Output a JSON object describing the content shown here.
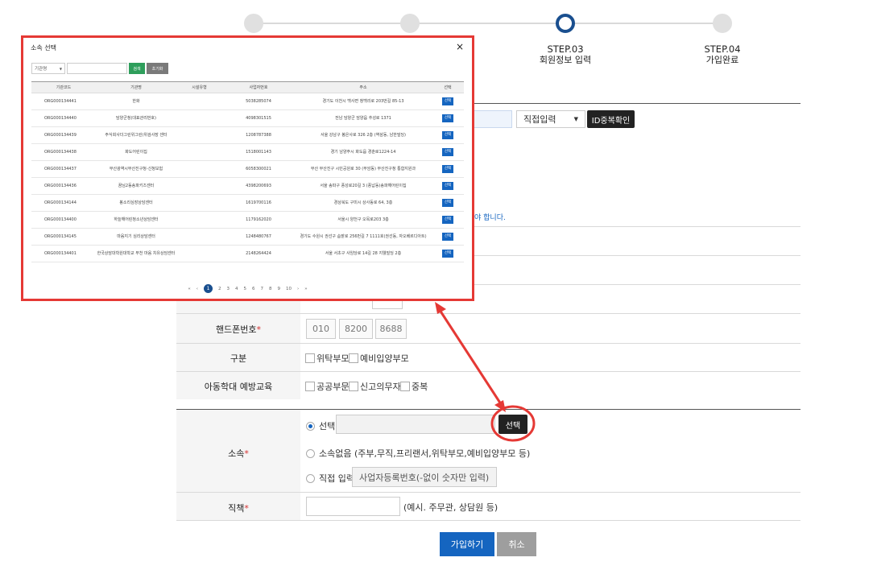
{
  "steps": [
    {
      "num": "",
      "label": ""
    },
    {
      "num": "",
      "label": ""
    },
    {
      "num": "STEP.03",
      "label": "회원정보 입력"
    },
    {
      "num": "STEP.04",
      "label": "가입완료"
    }
  ],
  "id_row": {
    "domain_select": "직접입력",
    "check_button": "ID중복확인"
  },
  "notice_fragment": "야 합니다.",
  "phone": {
    "label": "핸드폰번호",
    "parts": [
      "010",
      "8200",
      "8688"
    ]
  },
  "category": {
    "label": "구분",
    "options": [
      "위탁부모",
      "예비입양부모"
    ]
  },
  "education": {
    "label": "아동학대 예방교육",
    "options": [
      "공공부문",
      "신고의무자",
      "중복"
    ]
  },
  "affiliation": {
    "label": "소속",
    "select_option": "선택",
    "select_button": "선택",
    "none_option": "소속없음 (주부,무직,프리랜서,위탁부모,예비입양부모 등)",
    "direct_option": "직접 입력",
    "direct_placeholder": "사업자등록번호(-없이 숫자만 입력)"
  },
  "position": {
    "label": "직책",
    "hint": "(예시. 주무관, 상담원 등)"
  },
  "buttons": {
    "submit": "가입하기",
    "cancel": "취소"
  },
  "modal": {
    "title": "소속 선택",
    "close": "×",
    "search_select": "기관명",
    "search_button": "검색",
    "reset_button": "초기화",
    "columns": [
      "기관코드",
      "기관명",
      "시설유형",
      "사업자번호",
      "주소",
      "선택"
    ],
    "rows": [
      {
        "code": "ORG000134441",
        "name": "한화",
        "type": "",
        "biz": "5038285074",
        "addr": "경기도 이천시 백사면 청백리로 203번길 85-13",
        "sel": "선택"
      },
      {
        "code": "ORG000134440",
        "name": "담양군청(대표관리번호)",
        "type": "",
        "biz": "4098301515",
        "addr": "전남 담양군 담양읍 추성로 1371",
        "sel": "선택"
      },
      {
        "code": "ORG000134439",
        "name": "주식회사더그린위그린(위검사장 센터",
        "type": "",
        "biz": "1208787388",
        "addr": "서울 강남구 봉은사로 326 2층 (역삼동, 남한빌딩)",
        "sel": "선택"
      },
      {
        "code": "ORG000134438",
        "name": "화도어린이집",
        "type": "",
        "biz": "1518001143",
        "addr": "경기 남양주시 화도읍 경춘로1224-14",
        "sel": "선택"
      },
      {
        "code": "ORG000134437",
        "name": "부산광역시부산진구청-신청보험",
        "type": "",
        "biz": "6058300021",
        "addr": "부산 부산진구 시민공원로 30 (부암동) 부산진구청 통합지원과",
        "sel": "선택"
      },
      {
        "code": "ORG000134436",
        "name": "꿈님2동송파키즈센터",
        "type": "",
        "biz": "4398200693",
        "addr": "서울 송파구 풍성로20길 3 (풍납동)송파해어린이집",
        "sel": "선택"
      },
      {
        "code": "ORG000134144",
        "name": "봉소리심장상담센터",
        "type": "",
        "biz": "1619700116",
        "addr": "경상북도 구미시 상사동로 64, 3층",
        "sel": "선택"
      },
      {
        "code": "ORG000134400",
        "name": "하늘해어린청소년상담센터",
        "type": "",
        "biz": "1179162020",
        "addr": "서울시 양천구 오목로203 3층",
        "sel": "선택"
      },
      {
        "code": "ORG000134145",
        "name": "마음지기 심리상담센터",
        "type": "",
        "biz": "1248480767",
        "addr": "경기도 수원시 권선구 솜밭로 256번길 7 1111호(권선동, 자오베르디아트)",
        "sel": "선택"
      },
      {
        "code": "ORG000134401",
        "name": "한국상담대학원대학교 부천 마음 치유상담센터",
        "type": "",
        "biz": "2148264424",
        "addr": "서울 서초구 사임당로 14길 28 지웰빌딩 2층",
        "sel": "선택"
      }
    ],
    "pager": {
      "first": "«",
      "prev": "‹",
      "pages": [
        "1",
        "2",
        "3",
        "4",
        "5",
        "6",
        "7",
        "8",
        "9",
        "10"
      ],
      "next": "›",
      "last": "»"
    }
  },
  "colors": {
    "annotation_red": "#e53935",
    "primary_blue": "#1565c0",
    "step_active": "#1a4f8f"
  }
}
